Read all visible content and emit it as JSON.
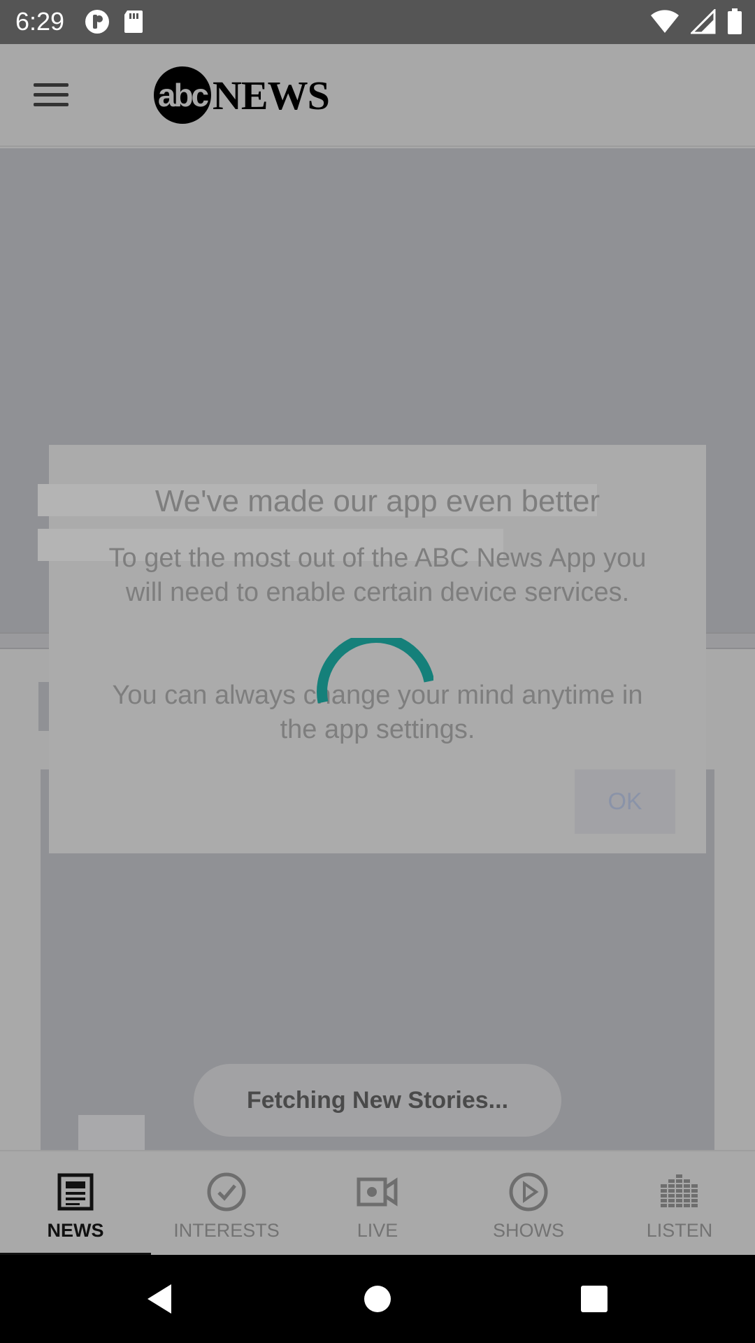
{
  "status_bar": {
    "time": "6:29",
    "left_icons": [
      "privacy-indicator-icon",
      "sd-card-icon"
    ],
    "right_icons": [
      "wifi-icon",
      "cellular-signal-icon",
      "battery-icon"
    ]
  },
  "app_bar": {
    "logo_abc": "abc",
    "logo_news": "NEWS",
    "menu_icon": "hamburger-menu-icon"
  },
  "feed": {
    "loading_toast": "Fetching New Stories..."
  },
  "dialog": {
    "title": "We've made our app even better",
    "body_1": "To get the most out of the ABC News App you will need to enable certain device services.",
    "body_2": "You can always change your mind anytime in the app settings.",
    "ok_label": "OK"
  },
  "spinner": {
    "color": "#15807a"
  },
  "bottom_nav": {
    "items": [
      {
        "label": "NEWS",
        "icon": "newspaper-icon",
        "active": true
      },
      {
        "label": "INTERESTS",
        "icon": "check-circle-icon",
        "active": false
      },
      {
        "label": "LIVE",
        "icon": "video-camera-icon",
        "active": false
      },
      {
        "label": "SHOWS",
        "icon": "play-circle-icon",
        "active": false
      },
      {
        "label": "LISTEN",
        "icon": "equalizer-icon",
        "active": false
      }
    ]
  },
  "system_nav": {
    "icons": [
      "back-icon",
      "home-icon",
      "recents-icon"
    ]
  }
}
